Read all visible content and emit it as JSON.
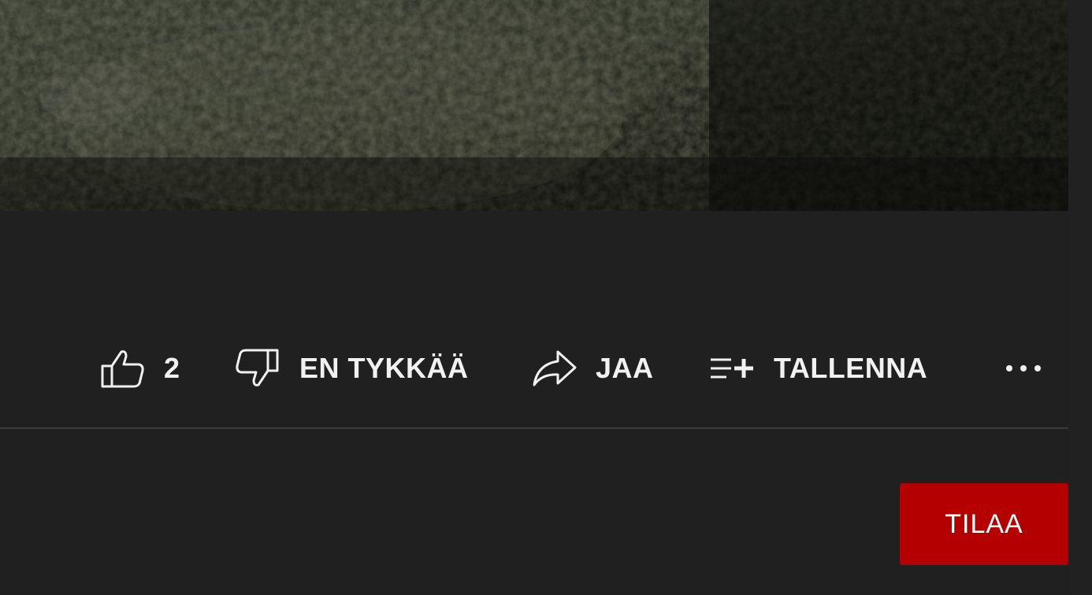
{
  "video": {
    "thumbnail_icon": "dark-night-footage"
  },
  "actions": {
    "like": {
      "icon": "thumbs-up-icon",
      "count": "2"
    },
    "dislike": {
      "icon": "thumbs-down-icon",
      "label": "EN TYKKÄÄ"
    },
    "share": {
      "icon": "share-arrow-icon",
      "label": "JAA"
    },
    "save": {
      "icon": "playlist-add-icon",
      "label": "TALLENNA"
    },
    "more": {
      "icon": "more-horizontal-icon"
    }
  },
  "subscribe": {
    "label": "TILAA",
    "color": "#b50000"
  },
  "colors": {
    "background": "#202020",
    "text": "#f1f1f1",
    "divider": "#3a3a3a"
  }
}
